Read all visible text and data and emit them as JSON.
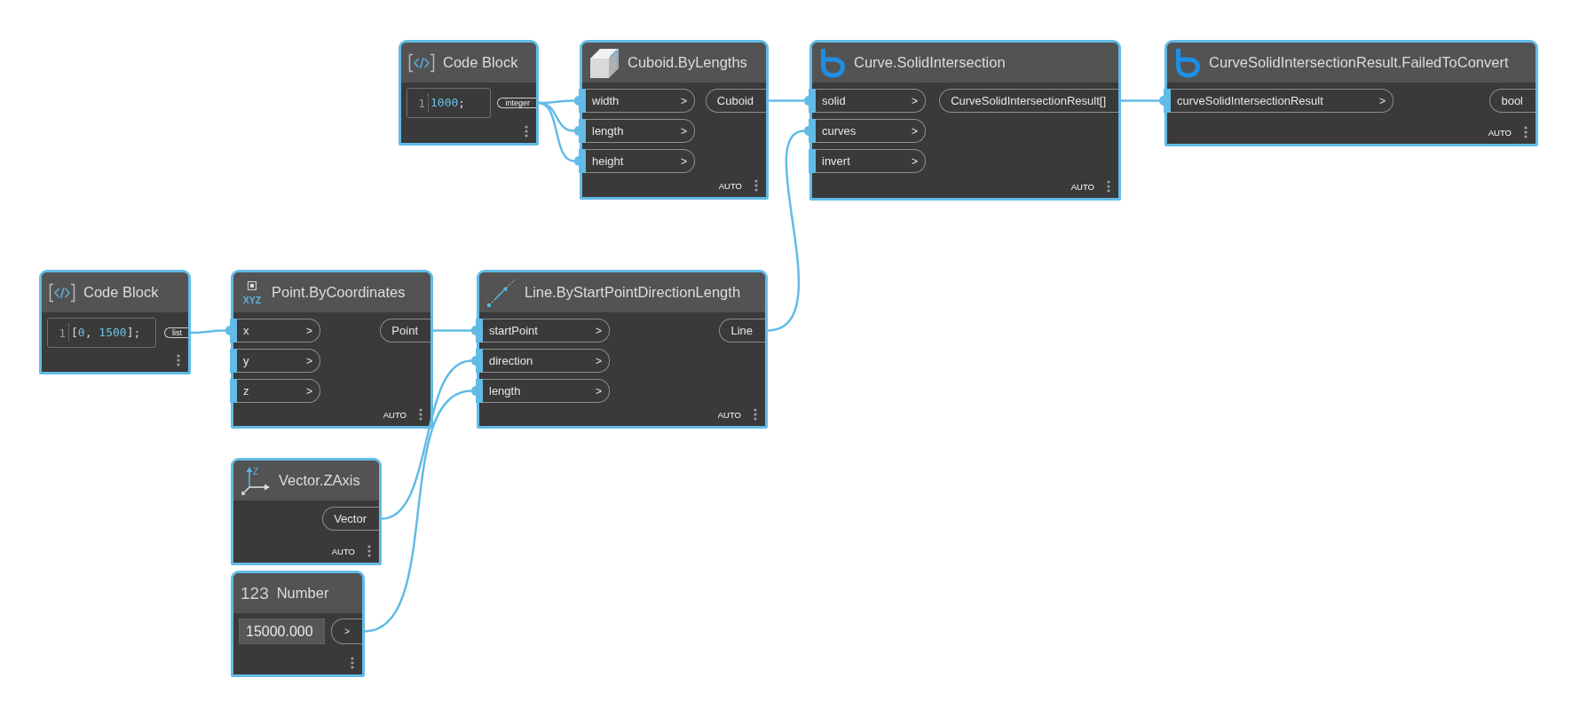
{
  "canvas": {
    "nodes": [
      {
        "kind": "code",
        "title": "Code Block",
        "line_number": "1",
        "code": [
          {
            "text": "1000",
            "kind": "number"
          },
          {
            "text": ";",
            "kind": "punctuation"
          }
        ],
        "outputs": [
          {
            "label": "integer"
          }
        ]
      },
      {
        "kind": "function",
        "title": "Cuboid.ByLengths",
        "inputs": [
          {
            "label": "width",
            "arrow": ">",
            "connected": true
          },
          {
            "label": "length",
            "arrow": ">",
            "connected": true
          },
          {
            "label": "height",
            "arrow": ">",
            "connected": true
          }
        ],
        "outputs": [
          {
            "label": "Cuboid"
          }
        ],
        "lacing": "AUTO"
      },
      {
        "kind": "function",
        "title": "Curve.SolidIntersection",
        "inputs": [
          {
            "label": "solid",
            "arrow": ">",
            "connected": true
          },
          {
            "label": "curves",
            "arrow": ">",
            "connected": true
          },
          {
            "label": "invert",
            "arrow": ">",
            "connected": false
          }
        ],
        "outputs": [
          {
            "label": "CurveSolidIntersectionResult[]"
          }
        ],
        "lacing": "AUTO"
      },
      {
        "kind": "function",
        "title": "CurveSolidIntersectionResult.FailedToConvert",
        "inputs": [
          {
            "label": "curveSolidIntersectionResult",
            "arrow": ">",
            "connected": true
          }
        ],
        "outputs": [
          {
            "label": "bool"
          }
        ],
        "lacing": "AUTO"
      },
      {
        "kind": "code",
        "title": "Code Block",
        "line_number": "1",
        "code": [
          {
            "text": "[",
            "kind": "punctuation"
          },
          {
            "text": "0",
            "kind": "number"
          },
          {
            "text": ", ",
            "kind": "punctuation"
          },
          {
            "text": "1500",
            "kind": "number"
          },
          {
            "text": "];",
            "kind": "punctuation"
          }
        ],
        "outputs": [
          {
            "label": "list"
          }
        ]
      },
      {
        "kind": "function",
        "title": "Point.ByCoordinates",
        "icon_text": "XYZ",
        "inputs": [
          {
            "label": "x",
            "arrow": ">",
            "connected": true
          },
          {
            "label": "y",
            "arrow": ">",
            "connected": false
          },
          {
            "label": "z",
            "arrow": ">",
            "connected": false
          }
        ],
        "outputs": [
          {
            "label": "Point"
          }
        ],
        "lacing": "AUTO"
      },
      {
        "kind": "function",
        "title": "Line.ByStartPointDirectionLength",
        "inputs": [
          {
            "label": "startPoint",
            "arrow": ">",
            "connected": true
          },
          {
            "label": "direction",
            "arrow": ">",
            "connected": true
          },
          {
            "label": "length",
            "arrow": ">",
            "connected": true
          }
        ],
        "outputs": [
          {
            "label": "Line"
          }
        ],
        "lacing": "AUTO"
      },
      {
        "kind": "function",
        "title": "Vector.ZAxis",
        "icon_text": "Z",
        "outputs": [
          {
            "label": "Vector"
          }
        ],
        "lacing": "AUTO"
      },
      {
        "kind": "number",
        "title": "Number",
        "icon_text": "123",
        "value": "15000.000",
        "outputs": [
          {
            "label": ">"
          }
        ]
      }
    ]
  }
}
